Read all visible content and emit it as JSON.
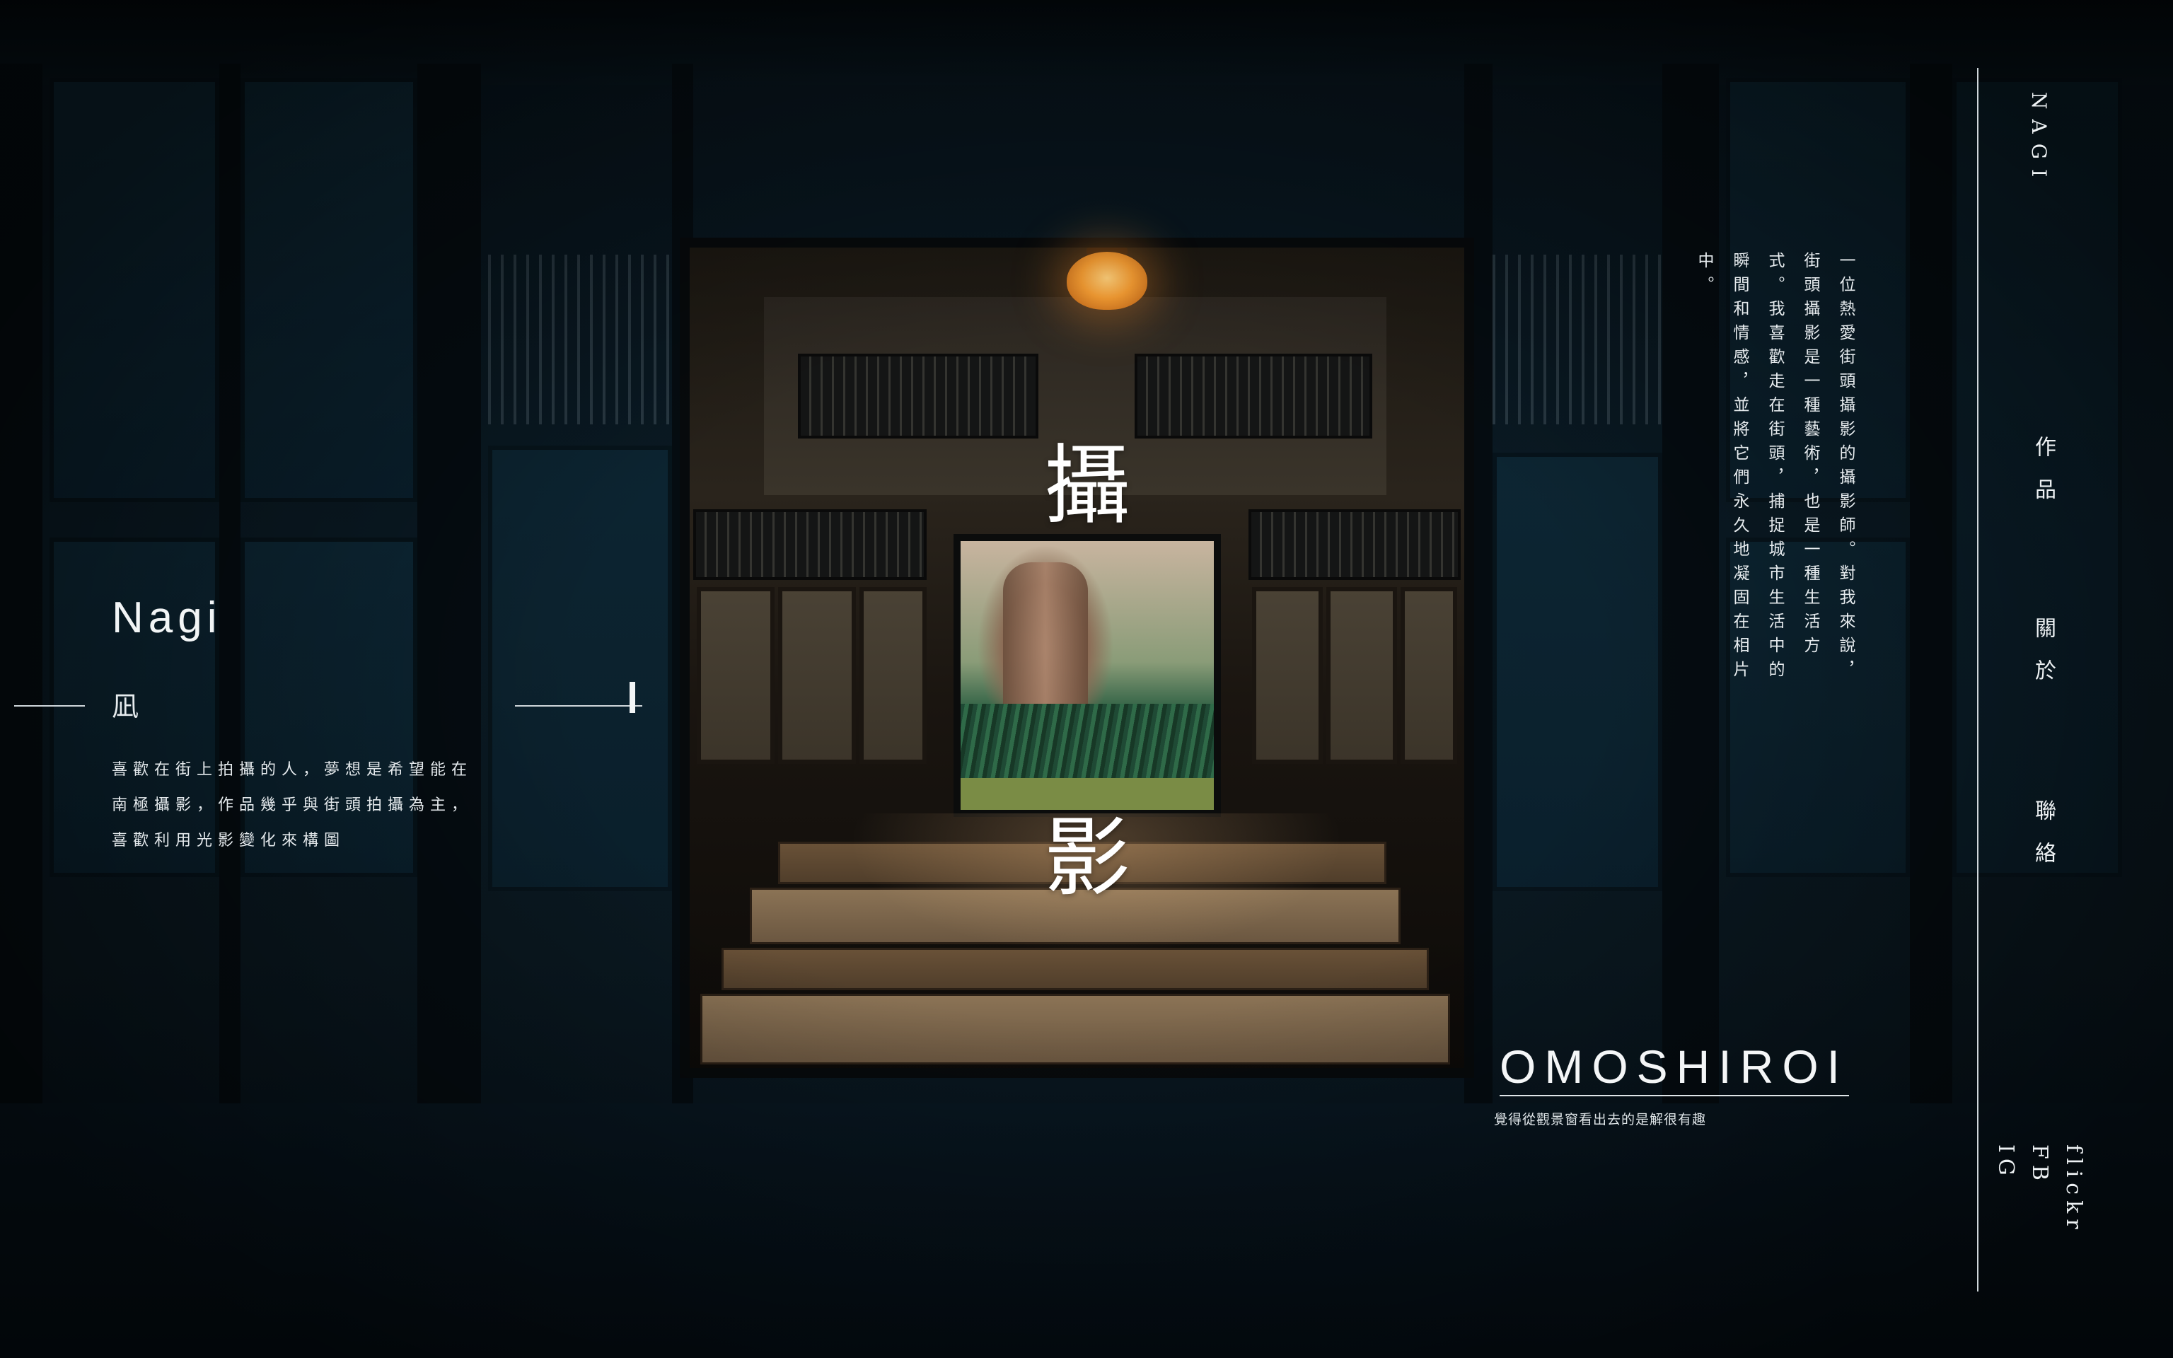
{
  "left_panel": {
    "name": "Nagi",
    "kanji": "凪",
    "description_lines": [
      "喜歡在街上拍攝的人，夢想是希望能在",
      "南極攝影，作品幾乎與街頭拍攝為主，",
      "喜歡利用光影變化來構圖"
    ]
  },
  "hero": {
    "top_char": "攝",
    "bottom_char": "影"
  },
  "intro": {
    "text": "一位熱愛街頭攝影的攝影師。對我來說，街頭攝影是一種藝術，也是一種生活方式。我喜歡走在街頭，捕捉城市生活中的瞬間和情感，並將它們永久地凝固在相片中。"
  },
  "brand": {
    "title": "OMOSHIROI",
    "subtitle": "覺得從觀景窗看出去的是解很有趣"
  },
  "sidebar": {
    "logo": "NAGI",
    "nav": {
      "works": "作品",
      "about": "關於",
      "contact": "聯絡"
    },
    "social": {
      "flickr": "flickr",
      "fb": "FB",
      "ig": "IG"
    }
  }
}
